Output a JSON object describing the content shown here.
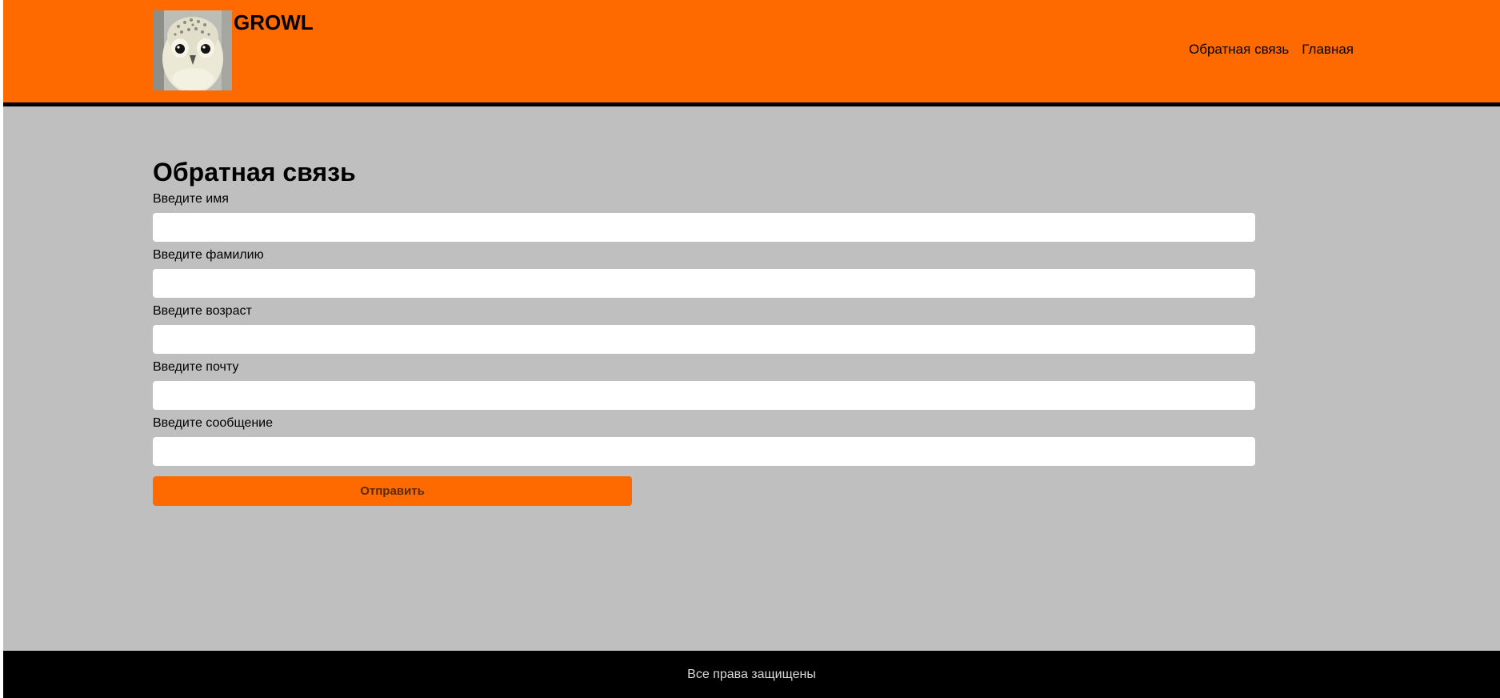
{
  "header": {
    "brand": "GROWL",
    "logo_icon": "owl-photo-icon",
    "nav": [
      {
        "label": "Обратная связь"
      },
      {
        "label": "Главная"
      }
    ]
  },
  "form": {
    "title": "Обратная связь",
    "fields": [
      {
        "label": "Введите имя",
        "value": ""
      },
      {
        "label": "Введите фамилию",
        "value": ""
      },
      {
        "label": "Введите возраст",
        "value": ""
      },
      {
        "label": "Введите почту",
        "value": ""
      },
      {
        "label": "Введите сообщение",
        "value": ""
      }
    ],
    "submit_label": "Отправить"
  },
  "footer": {
    "text": "Все права защищены"
  },
  "colors": {
    "accent": "#ff6a00",
    "background": "#bfbfbf",
    "footer": "#000000"
  }
}
